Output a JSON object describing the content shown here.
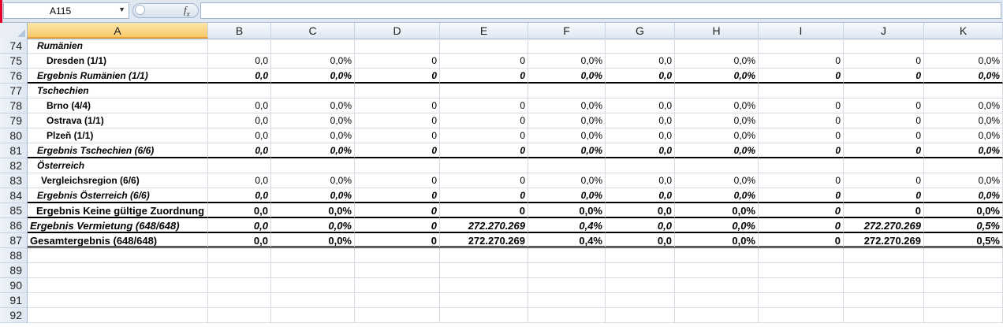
{
  "formula_bar": {
    "name_box": "A115",
    "fx": "fx",
    "formula": ""
  },
  "columns": [
    "A",
    "B",
    "C",
    "D",
    "E",
    "F",
    "G",
    "H",
    "I",
    "J",
    "K"
  ],
  "selected_column": "A",
  "rows": [
    {
      "num": "74",
      "a": "Rumänien",
      "style": "header",
      "vals": [
        "",
        "",
        "",
        "",
        "",
        "",
        "",
        "",
        "",
        ""
      ]
    },
    {
      "num": "75",
      "a": "Dresden (1/1)",
      "style": "item",
      "vals": [
        "0,0",
        "0,0%",
        "0",
        "0",
        "0,0%",
        "0,0",
        "0,0%",
        "0",
        "0",
        "0,0%"
      ]
    },
    {
      "num": "76",
      "a": "Ergebnis Rumänien (1/1)",
      "style": "subtotal",
      "vals": [
        "0,0",
        "0,0%",
        "0",
        "0",
        "0,0%",
        "0,0",
        "0,0%",
        "0",
        "0",
        "0,0%"
      ]
    },
    {
      "num": "77",
      "a": "Tschechien",
      "style": "header",
      "vals": [
        "",
        "",
        "",
        "",
        "",
        "",
        "",
        "",
        "",
        ""
      ]
    },
    {
      "num": "78",
      "a": "Brno (4/4)",
      "style": "item",
      "vals": [
        "0,0",
        "0,0%",
        "0",
        "0",
        "0,0%",
        "0,0",
        "0,0%",
        "0",
        "0",
        "0,0%"
      ]
    },
    {
      "num": "79",
      "a": "Ostrava (1/1)",
      "style": "item",
      "vals": [
        "0,0",
        "0,0%",
        "0",
        "0",
        "0,0%",
        "0,0",
        "0,0%",
        "0",
        "0",
        "0,0%"
      ]
    },
    {
      "num": "80",
      "a": "Plzeň (1/1)",
      "style": "item",
      "vals": [
        "0,0",
        "0,0%",
        "0",
        "0",
        "0,0%",
        "0,0",
        "0,0%",
        "0",
        "0",
        "0,0%"
      ]
    },
    {
      "num": "81",
      "a": "Ergebnis Tschechien (6/6)",
      "style": "subtotal",
      "vals": [
        "0,0",
        "0,0%",
        "0",
        "0",
        "0,0%",
        "0,0",
        "0,0%",
        "0",
        "0",
        "0,0%"
      ]
    },
    {
      "num": "82",
      "a": "Österreich",
      "style": "header",
      "vals": [
        "",
        "",
        "",
        "",
        "",
        "",
        "",
        "",
        "",
        ""
      ]
    },
    {
      "num": "83",
      "a": "Vergleichsregion (6/6)",
      "style": "item2",
      "vals": [
        "0,0",
        "0,0%",
        "0",
        "0",
        "0,0%",
        "0,0",
        "0,0%",
        "0",
        "0",
        "0,0%"
      ]
    },
    {
      "num": "84",
      "a": "Ergebnis Österreich (6/6)",
      "style": "subtotal",
      "vals": [
        "0,0",
        "0,0%",
        "0",
        "0",
        "0,0%",
        "0,0",
        "0,0%",
        "0",
        "0",
        "0,0%"
      ]
    },
    {
      "num": "85",
      "a": "Ergebnis Keine gültige Zuordnung",
      "style": "keine",
      "vals": [
        "0,0",
        "0,0%",
        "0",
        "0",
        "0,0%",
        "0,0",
        "0,0%",
        "0",
        "0",
        "0,0%"
      ]
    },
    {
      "num": "86",
      "a": "Ergebnis Vermietung (648/648)",
      "style": "vermietung",
      "vals": [
        "0,0",
        "0,0%",
        "0",
        "272.270.269",
        "0,4%",
        "0,0",
        "0,0%",
        "0",
        "272.270.269",
        "0,5%"
      ]
    },
    {
      "num": "87",
      "a": "Gesamtergebnis (648/648)",
      "style": "gesamt",
      "vals": [
        "0,0",
        "0,0%",
        "0",
        "272.270.269",
        "0,4%",
        "0,0",
        "0,0%",
        "0",
        "272.270.269",
        "0,5%"
      ]
    },
    {
      "num": "88",
      "a": "",
      "style": "empty",
      "vals": [
        "",
        "",
        "",
        "",
        "",
        "",
        "",
        "",
        "",
        ""
      ]
    },
    {
      "num": "89",
      "a": "",
      "style": "empty",
      "vals": [
        "",
        "",
        "",
        "",
        "",
        "",
        "",
        "",
        "",
        ""
      ]
    },
    {
      "num": "90",
      "a": "",
      "style": "empty",
      "vals": [
        "",
        "",
        "",
        "",
        "",
        "",
        "",
        "",
        "",
        ""
      ]
    },
    {
      "num": "91",
      "a": "",
      "style": "empty",
      "vals": [
        "",
        "",
        "",
        "",
        "",
        "",
        "",
        "",
        "",
        ""
      ]
    },
    {
      "num": "92",
      "a": "",
      "style": "empty",
      "vals": [
        "",
        "",
        "",
        "",
        "",
        "",
        "",
        "",
        "",
        ""
      ]
    }
  ]
}
